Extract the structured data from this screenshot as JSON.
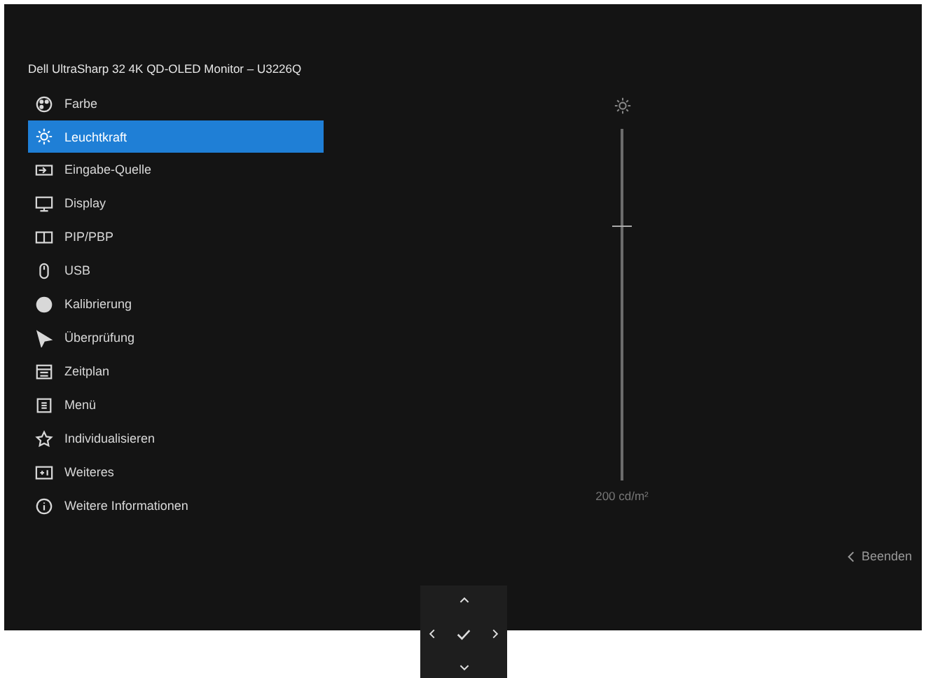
{
  "window": {
    "title": "Dell UltraSharp 32 4K QD-OLED Monitor – U3226Q"
  },
  "menu": [
    {
      "label": "Farbe",
      "selected": false
    },
    {
      "label": "Leuchtkraft",
      "selected": true
    },
    {
      "label": "Eingabe-Quelle",
      "selected": false
    },
    {
      "label": "Display",
      "selected": false
    },
    {
      "label": "PIP/PBP",
      "selected": false
    },
    {
      "label": "USB",
      "selected": false
    },
    {
      "label": "Kalibrierung",
      "selected": false
    },
    {
      "label": "Überprüfung",
      "selected": false
    },
    {
      "label": "Zeitplan",
      "selected": false
    },
    {
      "label": "Menü",
      "selected": false
    },
    {
      "label": "Individualisieren",
      "selected": false
    },
    {
      "label": "Weiteres",
      "selected": false
    },
    {
      "label": "Weitere Informationen",
      "selected": false
    }
  ],
  "brightness_slider": {
    "level": 0.72,
    "reading": "200 cd/m²"
  },
  "exit_button": {
    "label": "Beenden"
  }
}
